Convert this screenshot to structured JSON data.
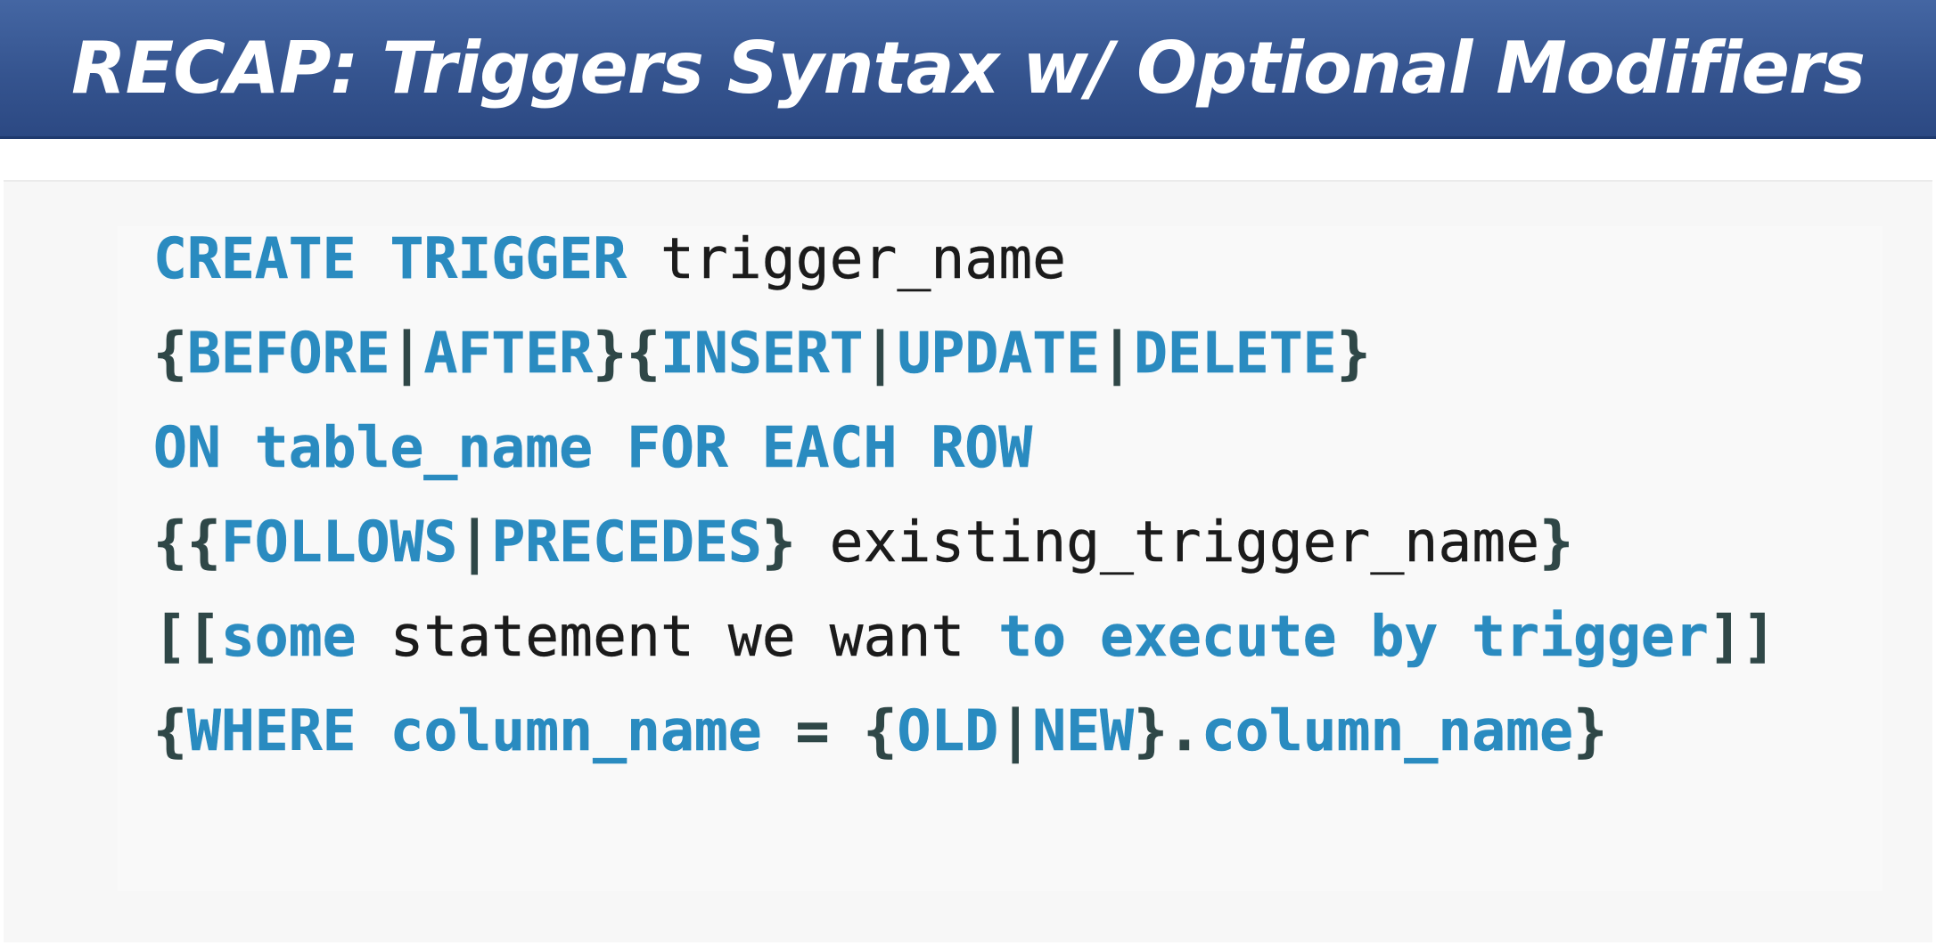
{
  "slide": {
    "title": "RECAP: Triggers Syntax w/ Optional Modifiers"
  },
  "colors": {
    "title_bar": "#35548f",
    "title_text": "#ffffff",
    "keyword": "#2a8bc0",
    "identifier": "#1b1b1b",
    "punctuation": "#2f4747",
    "code_background": "#f9f9f9"
  },
  "code": {
    "lines": [
      [
        {
          "text": "CREATE TRIGGER",
          "type": "kw"
        },
        {
          "text": " trigger_name",
          "type": "id"
        }
      ],
      [
        {
          "text": "{",
          "type": "punc"
        },
        {
          "text": "BEFORE",
          "type": "kw"
        },
        {
          "text": "|",
          "type": "punc"
        },
        {
          "text": "AFTER",
          "type": "kw"
        },
        {
          "text": "}{",
          "type": "punc"
        },
        {
          "text": "INSERT",
          "type": "kw"
        },
        {
          "text": "|",
          "type": "punc"
        },
        {
          "text": "UPDATE",
          "type": "kw"
        },
        {
          "text": "|",
          "type": "punc"
        },
        {
          "text": "DELETE",
          "type": "kw"
        },
        {
          "text": "}",
          "type": "punc"
        }
      ],
      [
        {
          "text": "ON table_name FOR EACH ROW",
          "type": "kw"
        }
      ],
      [
        {
          "text": "{{",
          "type": "punc"
        },
        {
          "text": "FOLLOWS",
          "type": "kw"
        },
        {
          "text": "|",
          "type": "punc"
        },
        {
          "text": "PRECEDES",
          "type": "kw"
        },
        {
          "text": "}",
          "type": "punc"
        },
        {
          "text": " existing_trigger_name",
          "type": "id"
        },
        {
          "text": "}",
          "type": "punc"
        }
      ],
      [
        {
          "text": "[[",
          "type": "punc"
        },
        {
          "text": "some",
          "type": "kw"
        },
        {
          "text": " statement we want ",
          "type": "id"
        },
        {
          "text": "to execute by trigger",
          "type": "kw"
        },
        {
          "text": "]]",
          "type": "punc"
        }
      ],
      [
        {
          "text": "{",
          "type": "punc"
        },
        {
          "text": "WHERE column_name",
          "type": "kw"
        },
        {
          "text": " = {",
          "type": "punc"
        },
        {
          "text": "OLD",
          "type": "kw"
        },
        {
          "text": "|",
          "type": "punc"
        },
        {
          "text": "NEW",
          "type": "kw"
        },
        {
          "text": "}.",
          "type": "punc"
        },
        {
          "text": "column_name",
          "type": "kw"
        },
        {
          "text": "}",
          "type": "punc"
        }
      ]
    ]
  }
}
